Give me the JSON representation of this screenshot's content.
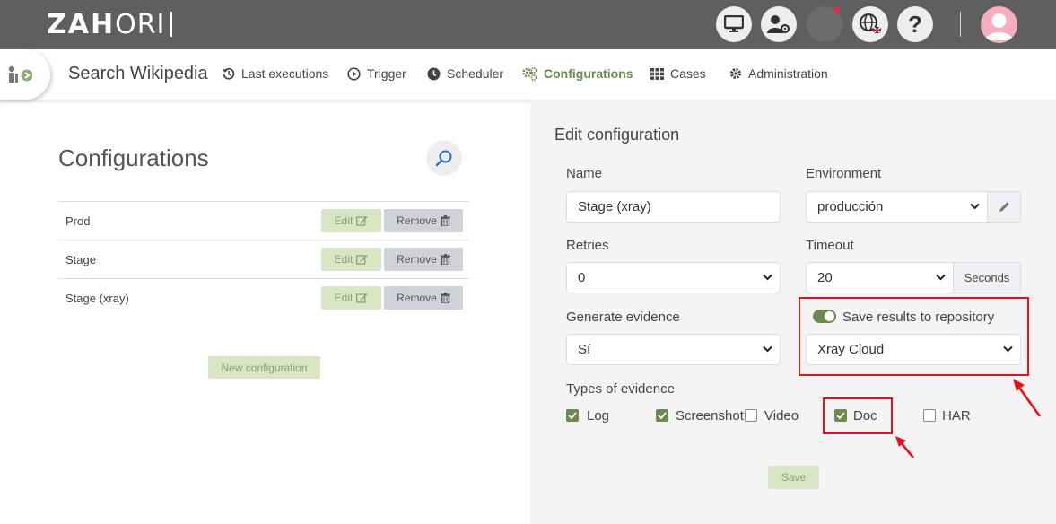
{
  "brand": {
    "logo_bold": "ZAH",
    "logo_thin": "ORI"
  },
  "header": {
    "icons": [
      "monitor-icon",
      "user-settings-icon",
      "notifications-icon",
      "language-icon",
      "help-icon"
    ],
    "help_label": "?"
  },
  "nav": {
    "title": "Search Wikipedia",
    "items": [
      {
        "label": "Last executions",
        "icon": "history-icon"
      },
      {
        "label": "Trigger",
        "icon": "play-icon"
      },
      {
        "label": "Scheduler",
        "icon": "clock-icon"
      },
      {
        "label": "Configurations",
        "icon": "cogs-icon",
        "active": true
      },
      {
        "label": "Cases",
        "icon": "grid-icon"
      },
      {
        "label": "Administration",
        "icon": "gear-icon"
      }
    ]
  },
  "configurations": {
    "title": "Configurations",
    "rows": [
      {
        "name": "Prod",
        "edit": "Edit",
        "remove": "Remove"
      },
      {
        "name": "Stage",
        "edit": "Edit",
        "remove": "Remove"
      },
      {
        "name": "Stage (xray)",
        "edit": "Edit",
        "remove": "Remove"
      }
    ],
    "new_button": "New configuration"
  },
  "edit": {
    "title": "Edit configuration",
    "name_label": "Name",
    "name_value": "Stage (xray)",
    "environment_label": "Environment",
    "environment_value": "producción",
    "retries_label": "Retries",
    "retries_value": "0",
    "timeout_label": "Timeout",
    "timeout_value": "20",
    "timeout_unit": "Seconds",
    "evidence_label": "Generate evidence",
    "evidence_value": "Sí",
    "save_repo_label": "Save results to repository",
    "save_repo_on": true,
    "repository_value": "Xray Cloud",
    "types_label": "Types of evidence",
    "types": [
      {
        "label": "Log",
        "checked": true
      },
      {
        "label": "Screenshot",
        "checked": true
      },
      {
        "label": "Video",
        "checked": false
      },
      {
        "label": "Doc",
        "checked": true
      },
      {
        "label": "HAR",
        "checked": false
      }
    ],
    "save_button": "Save"
  },
  "colors": {
    "accent": "#6d8a4f",
    "topbar": "#5f5f5f",
    "highlight": "#e8101a"
  }
}
